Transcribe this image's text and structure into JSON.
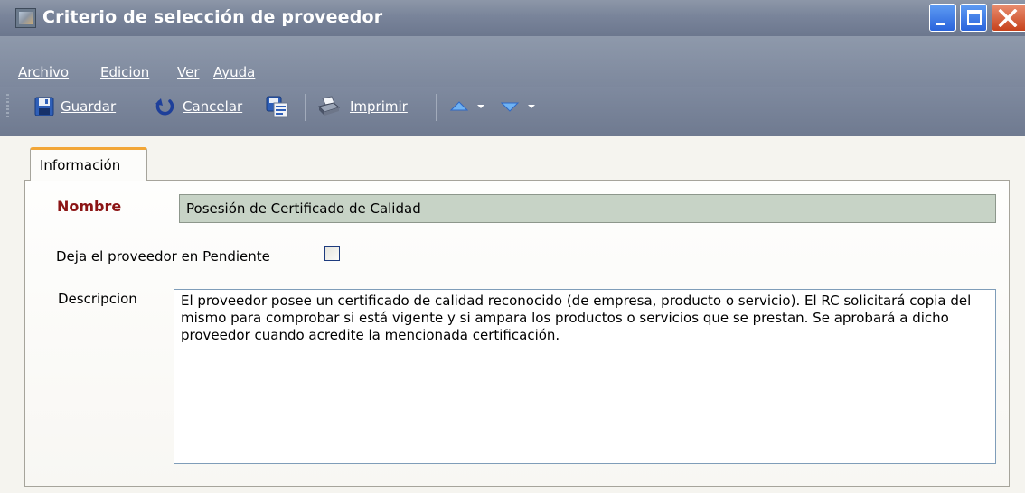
{
  "window": {
    "title": "Criterio de selección de proveedor",
    "colors": {
      "titlebar": "#7a859a",
      "close": "#d2542c",
      "min_max": "#3a72e6"
    }
  },
  "menu": {
    "items": [
      {
        "label": "Archivo"
      },
      {
        "label": "Edicion"
      },
      {
        "label": "Ver"
      },
      {
        "label": "Ayuda"
      }
    ]
  },
  "toolbar": {
    "save_label": "Guardar",
    "cancel_label": "Cancelar",
    "print_label": "Imprimir",
    "icons": [
      "save-icon",
      "undo-icon",
      "save-as-icon",
      "printer-icon",
      "navigate-up-icon",
      "navigate-down-icon"
    ]
  },
  "tabs": [
    {
      "label": "Información",
      "selected": true
    }
  ],
  "form": {
    "name_label": "Nombre",
    "name_value": "Posesión de Certificado de Calidad",
    "pending_label": "Deja el proveedor en Pendiente",
    "pending_checked": false,
    "description_label": "Descripcion",
    "description_value": "El proveedor posee un certificado de calidad reconocido (de empresa, producto o servicio). El RC solicitará copia del mismo para comprobar si está vigente y si ampara los productos o servicios que se prestan. Se aprobará a dicho proveedor cuando acredite la mencionada certificación."
  }
}
